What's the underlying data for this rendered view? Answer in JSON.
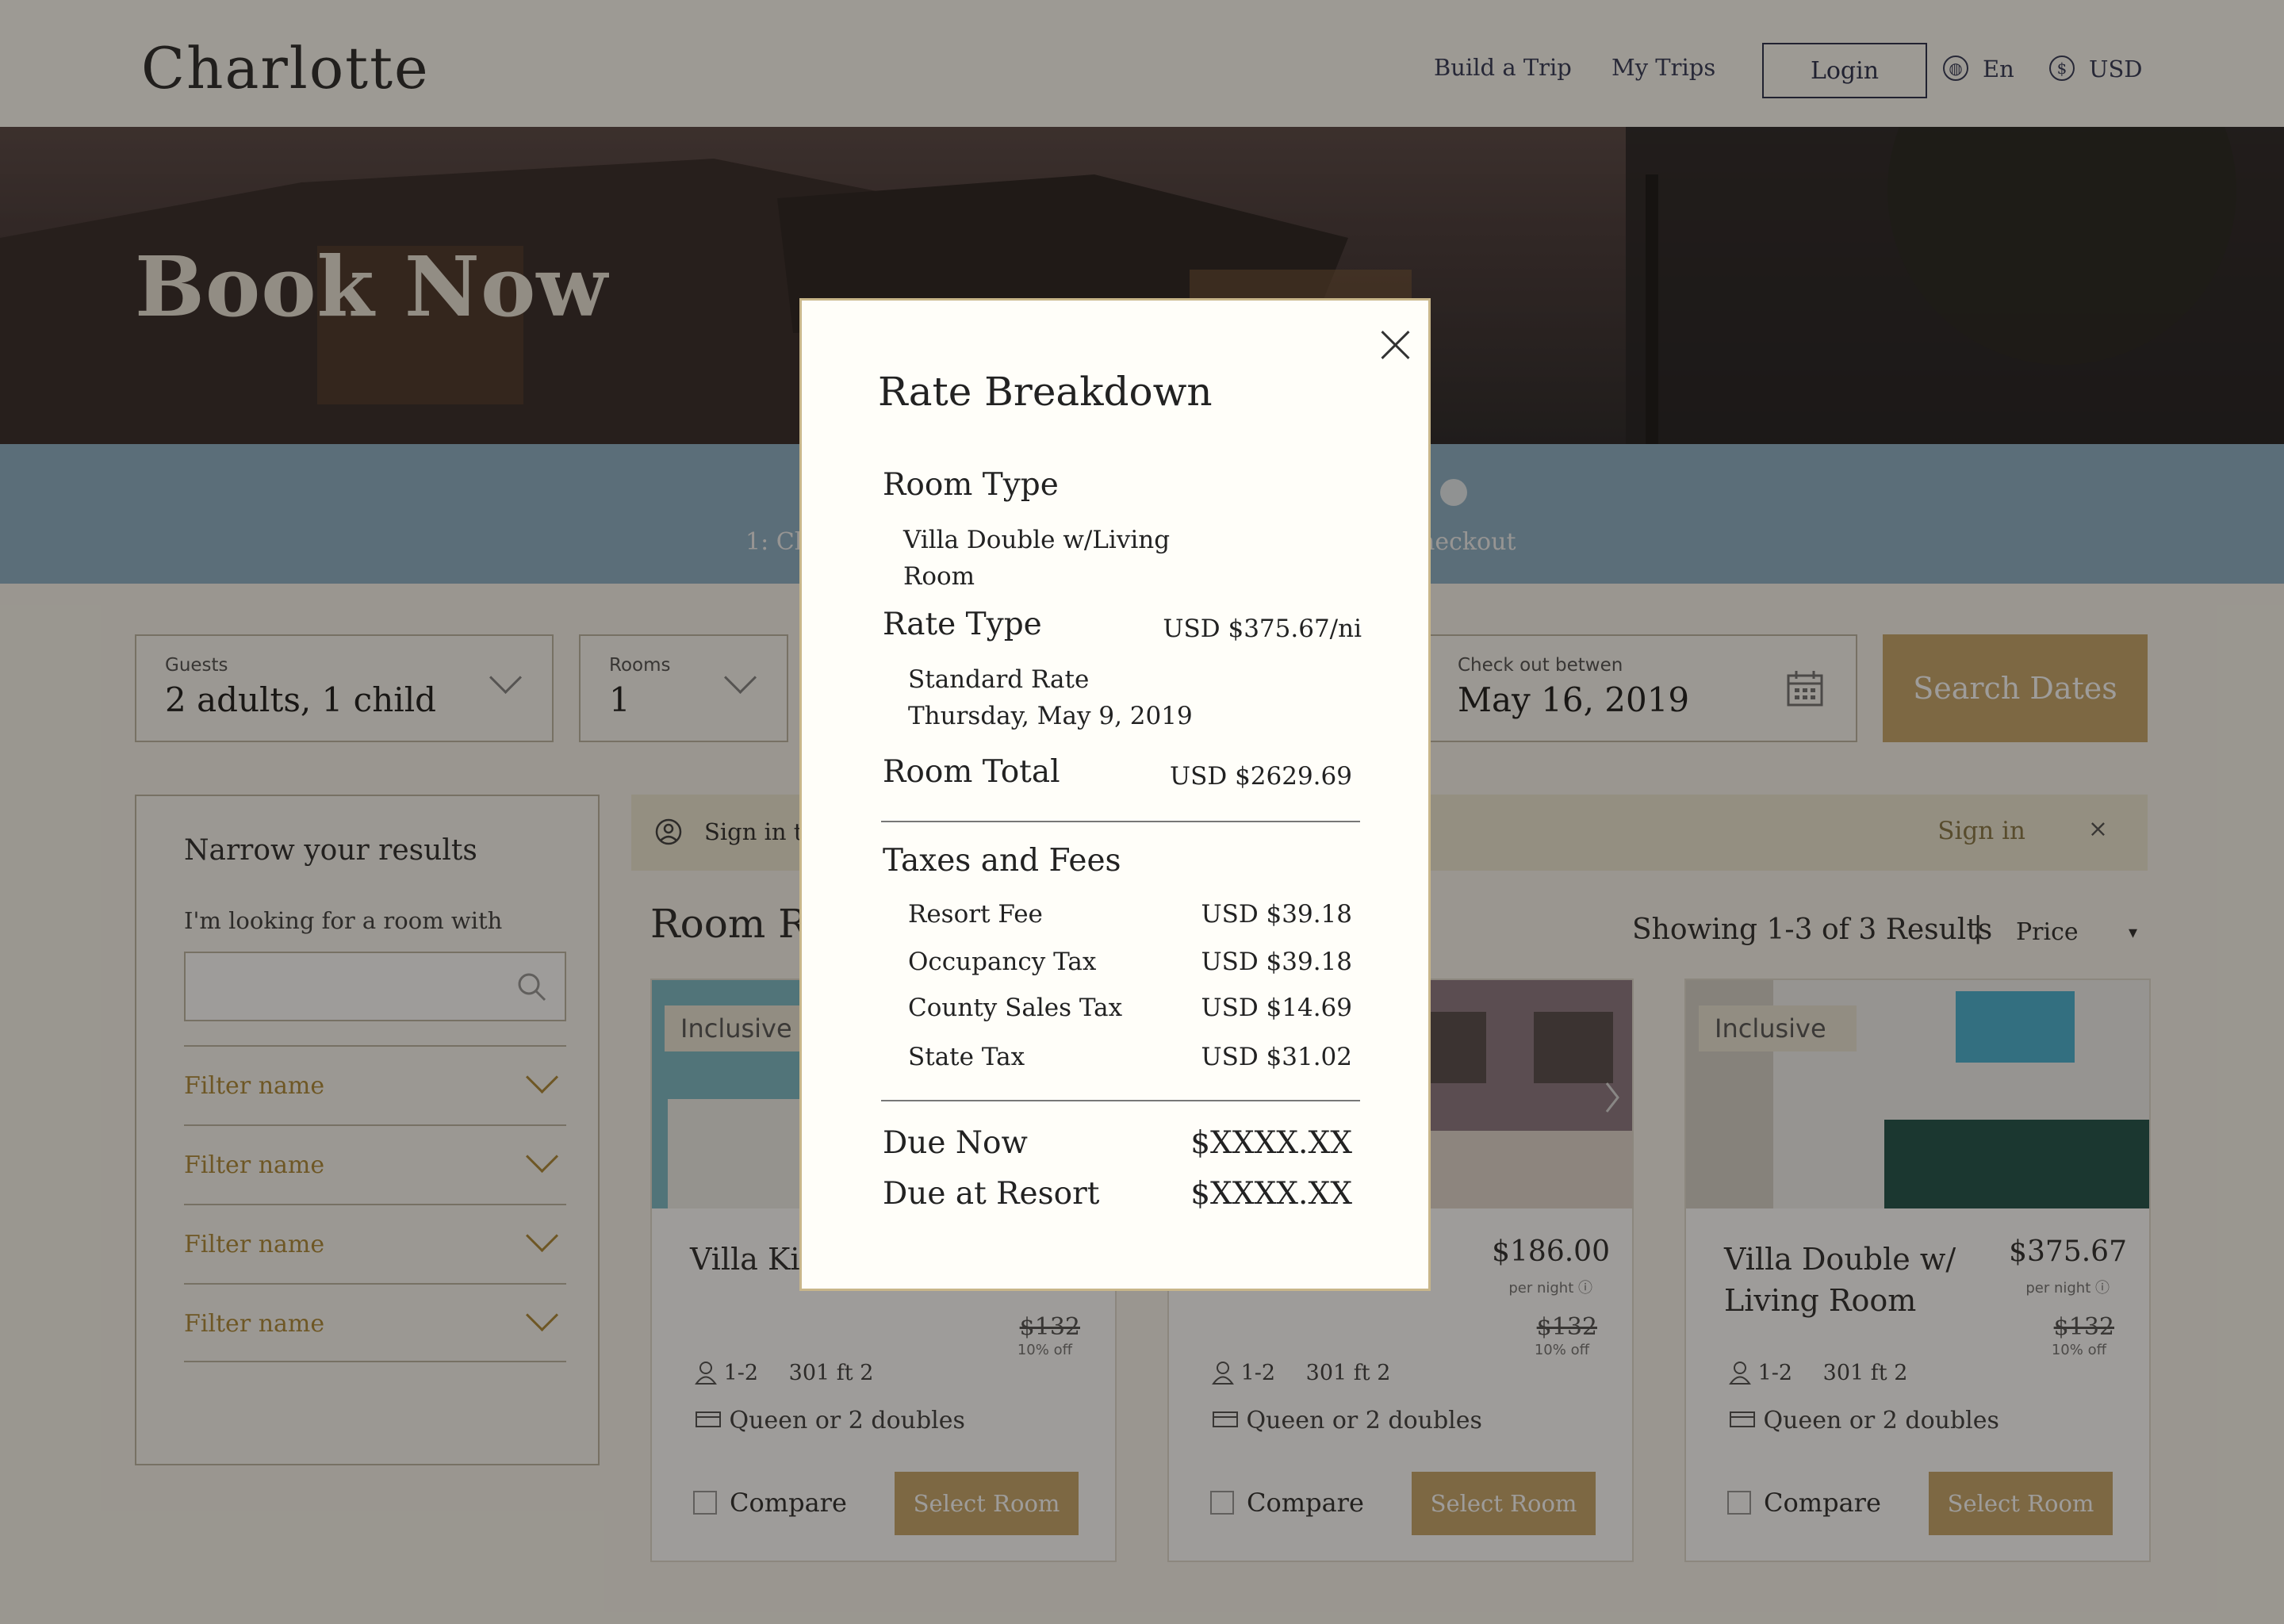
{
  "header": {
    "logo": "Charlotte",
    "nav": [
      "Build a Trip",
      "My Trips"
    ],
    "login": "Login",
    "language": "En",
    "currency": "USD"
  },
  "hero": {
    "title": "Book Now"
  },
  "steps": {
    "left_label": "1: Ch",
    "right_label": "heckout"
  },
  "search": {
    "guests_label": "Guests",
    "guests_value": "2 adults, 1 child",
    "rooms_label": "Rooms",
    "rooms_value": "1",
    "checkout_label": "Check out betwen",
    "checkout_value": "May 16, 2019",
    "button": "Search Dates"
  },
  "sidebar": {
    "title": "Narrow your results",
    "subtitle": "I'm looking for a room with",
    "filters": [
      "Filter name",
      "Filter name",
      "Filter name",
      "Filter name"
    ]
  },
  "signbar": {
    "text": "Sign in to",
    "link": "Sign in",
    "close": "×"
  },
  "results": {
    "title": "Room Re",
    "showing": "Showing 1-3 of 3 Results",
    "separator": "|",
    "sort_label": "Price",
    "sort_arrow": "▾"
  },
  "cards": [
    {
      "badge": "Inclusive",
      "name": "Villa Kin",
      "price": "",
      "per_night": "",
      "old_price": "$132",
      "off": "10% off",
      "occupancy": "1-2",
      "size": "301 ft 2",
      "bed": "Queen or 2 doubles",
      "compare": "Compare",
      "select": "Select Room"
    },
    {
      "badge": "",
      "name": "",
      "price": "$186.00",
      "per_night": "per night ⓘ",
      "old_price": "$132",
      "off": "10% off",
      "occupancy": "1-2",
      "size": "301 ft 2",
      "bed": "Queen or 2 doubles",
      "compare": "Compare",
      "select": "Select Room"
    },
    {
      "badge": "Inclusive",
      "name": "Villa Double w/ Living Room",
      "price": "$375.67",
      "per_night": "per night ⓘ",
      "old_price": "$132",
      "off": "10% off",
      "occupancy": "1-2",
      "size": "301 ft 2",
      "bed": "Queen or 2 doubles",
      "compare": "Compare",
      "select": "Select Room"
    }
  ],
  "modal": {
    "title": "Rate Breakdown",
    "room_type_heading": "Room Type",
    "room_type_line1": "Villa Double w/Living",
    "room_type_line2": "Room",
    "rate_type_heading": "Rate Type",
    "rate_type_value": "USD $375.67/ni",
    "rate_name": "Standard Rate",
    "rate_date": "Thursday, May 9, 2019",
    "room_total_label": "Room Total",
    "room_total_value": "USD $2629.69",
    "taxes_heading": "Taxes and Fees",
    "fees": [
      {
        "label": "Resort Fee",
        "value": "USD $39.18"
      },
      {
        "label": "Occupancy Tax",
        "value": "USD $39.18"
      },
      {
        "label": "County Sales Tax",
        "value": "USD $14.69"
      },
      {
        "label": "State Tax",
        "value": "USD $31.02"
      }
    ],
    "due_now_label": "Due Now",
    "due_now_value": "$XXXX.XX",
    "due_resort_label": "Due at Resort",
    "due_resort_value": "$XXXX.XX"
  },
  "colors": {
    "gold": "#c8a96e",
    "step_blue": "#8fb3c9",
    "modal_border": "#c8b68a"
  }
}
